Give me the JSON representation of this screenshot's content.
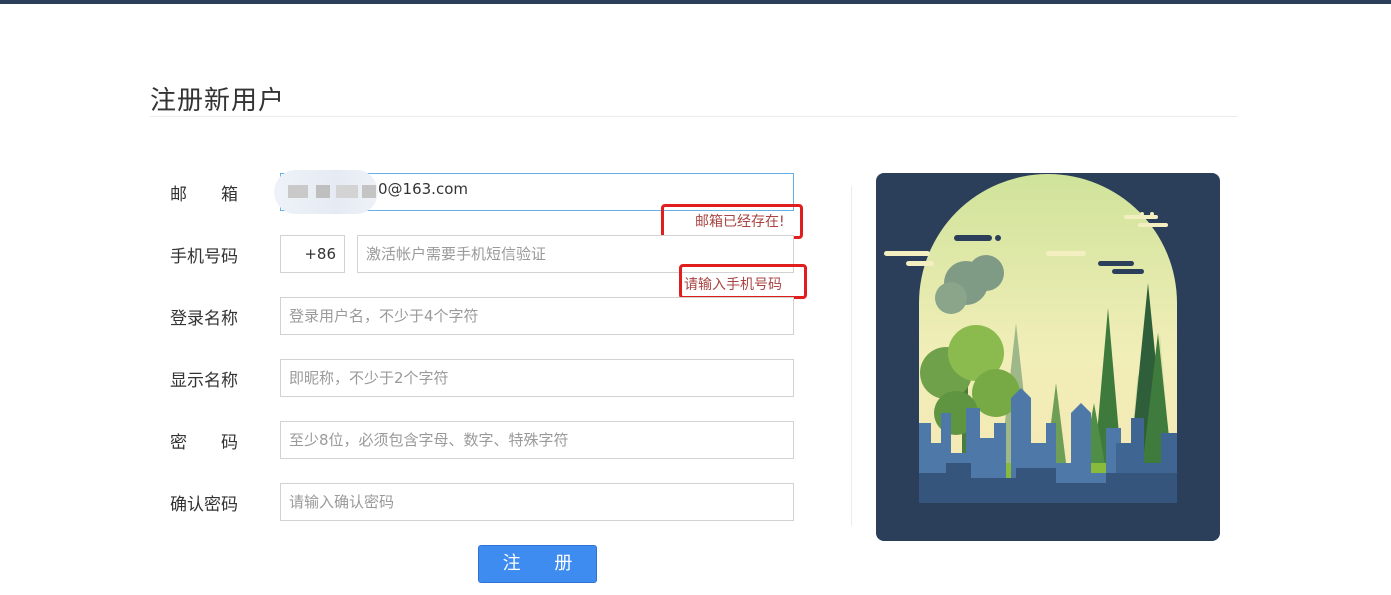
{
  "page": {
    "title": "注册新用户"
  },
  "form": {
    "email": {
      "label": "邮　　箱",
      "value_visible": "0@163.com",
      "error": "邮箱已经存在!"
    },
    "phone": {
      "label": "手机号码",
      "prefix": "+86",
      "placeholder": "激活帐户需要手机短信验证",
      "error": "请输入手机号码"
    },
    "login_name": {
      "label": "登录名称",
      "placeholder": "登录用户名，不少于4个字符"
    },
    "display_name": {
      "label": "显示名称",
      "placeholder": "即昵称，不少于2个字符"
    },
    "password": {
      "label": "密　　码",
      "placeholder": "至少8位，必须包含字母、数字、特殊字符"
    },
    "confirm_password": {
      "label": "确认密码",
      "placeholder": "请输入确认密码"
    },
    "submit_label": "注 册"
  },
  "colors": {
    "top_bar": "#2b3e5a",
    "error_text": "#a94442",
    "highlight_frame": "#e01e1e",
    "button": "#3f8cf0",
    "art_background": "#2b3e5a"
  }
}
